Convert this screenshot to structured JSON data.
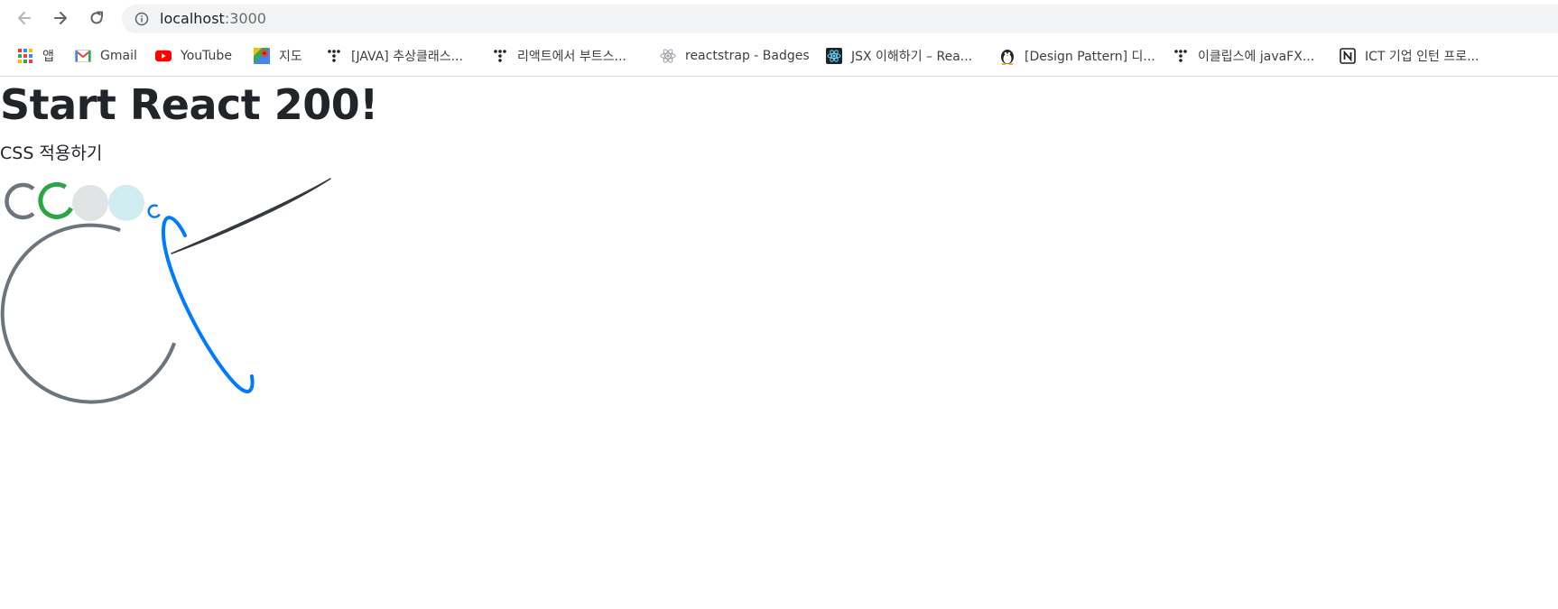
{
  "browser": {
    "url_host": "localhost",
    "url_port": ":3000",
    "icons": {
      "back": "back-arrow-icon",
      "forward": "forward-arrow-icon",
      "reload": "reload-icon",
      "info": "info-icon"
    }
  },
  "bookmarks": [
    {
      "label": "앱",
      "icon": "apps-grid-icon"
    },
    {
      "label": "Gmail",
      "icon": "gmail-icon"
    },
    {
      "label": "YouTube",
      "icon": "youtube-icon"
    },
    {
      "label": "지도",
      "icon": "maps-icon"
    },
    {
      "label": "[JAVA] 추상클래스...",
      "icon": "tistory-icon"
    },
    {
      "label": "리액트에서 부트스...",
      "icon": "tistory-icon"
    },
    {
      "label": "reactstrap - Badges",
      "icon": "react-atom-icon"
    },
    {
      "label": "JSX 이해하기 – Rea...",
      "icon": "react-icon"
    },
    {
      "label": "[Design Pattern] 디...",
      "icon": "penguin-icon"
    },
    {
      "label": "이클립스에 javaFX...",
      "icon": "tistory-icon"
    },
    {
      "label": "ICT 기업 인턴 프로...",
      "icon": "notion-icon"
    }
  ],
  "page": {
    "title": "Start React 200!",
    "subtitle": "CSS 적용하기"
  },
  "colors": {
    "secondary": "#6c757d",
    "success": "#28a745",
    "light": "#e2e3e5",
    "info_light": "#d1ecf1",
    "primary": "#007bff",
    "dark": "#343a40",
    "text": "#212529"
  }
}
